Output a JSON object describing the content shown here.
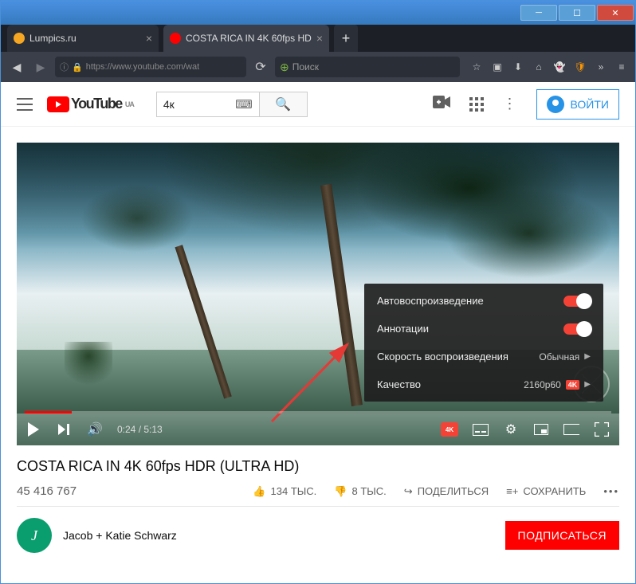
{
  "window": {
    "tabs": [
      {
        "favicon_color": "#f5a623",
        "title": "Lumpics.ru",
        "active": false
      },
      {
        "favicon_color": "#ff0000",
        "title": "COSTA RICA IN 4K 60fps HD",
        "active": true
      }
    ],
    "url": "https://www.youtube.com/wat",
    "search_placeholder": "Поиск"
  },
  "youtube_header": {
    "logo_text": "YouTube",
    "region": "UA",
    "search_value": "4к",
    "signin_label": "ВОЙТИ"
  },
  "player": {
    "time_current": "0:24",
    "time_total": "5:13",
    "settings_menu": {
      "autoplay_label": "Автовоспроизведение",
      "annotations_label": "Аннотации",
      "speed_label": "Скорость воспроизведения",
      "speed_value": "Обычная",
      "quality_label": "Качество",
      "quality_value": "2160p60",
      "quality_badge": "4K"
    }
  },
  "video_meta": {
    "title": "COSTA RICA IN 4K 60fps HDR (ULTRA HD)",
    "views": "45 416 767",
    "likes": "134 ТЫС.",
    "dislikes": "8 ТЫС.",
    "share_label": "ПОДЕЛИТЬСЯ",
    "save_label": "СОХРАНИТЬ",
    "channel_name": "Jacob + Katie Schwarz",
    "subscribe_label": "ПОДПИСАТЬСЯ"
  }
}
